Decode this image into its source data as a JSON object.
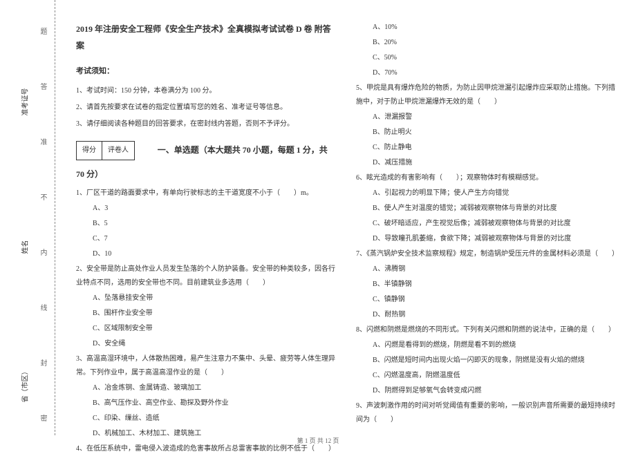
{
  "binding": {
    "field_province": "省（市区）",
    "field_name": "姓名",
    "field_ticket": "准考证号",
    "dash1": "密",
    "dash2": "封",
    "dash3": "线",
    "dash4": "内",
    "dash5": "不",
    "dash6": "准",
    "dash7": "答",
    "dash8": "题"
  },
  "header": {
    "title": "2019 年注册安全工程师《安全生产技术》全真模拟考试试卷 D 卷 附答案",
    "notice_label": "考试须知：",
    "instr1": "1、考试时间：150 分钟，本卷满分为 100 分。",
    "instr2": "2、请首先按要求在试卷的指定位置填写您的姓名、准考证号等信息。",
    "instr3": "3、请仔细阅读各种题目的回答要求，在密封线内答题，否则不予评分。"
  },
  "score_box": {
    "col1": "得分",
    "col2": "评卷人"
  },
  "section1_title": "一、单选题（本大题共 70 小题，每题 1 分，共 70 分）",
  "q1": {
    "stem": "1、厂区干道的路面要求中，有单向行驶标志的主干道宽度不小于（　　）m。",
    "a": "A、3",
    "b": "B、5",
    "c": "C、7",
    "d": "D、10"
  },
  "q2": {
    "stem": "2、安全带是防止高处作业人员发生坠落的个人防护装备。安全带的种类较多，因各行业特点不同，选用的安全带也不同。目前建筑业多选用（　　）",
    "a": "A、坠落悬挂安全带",
    "b": "B、围杆作业安全带",
    "c": "C、区域限制安全带",
    "d": "D、安全绳"
  },
  "q3": {
    "stem": "3、高温高湿环境中，人体散热困难，易产生注意力不集中、头晕、疲劳等人体生理异常。下列作业中，属于高温高湿作业的是（　　）",
    "a": "A、冶金炼钢、金属铸造、玻璃加工",
    "b": "B、高气压作业、高空作业、勘探及野外作业",
    "c": "C、印染、缫丝、造纸",
    "d": "D、机械加工、木材加工、建筑施工"
  },
  "q4": {
    "stem": "4、在低压系统中，雷电侵入波造成的危害事故所占总雷害事故的比例不低于（　　）"
  },
  "q4_opts": {
    "a": "A、10%",
    "b": "B、20%",
    "c": "C、50%",
    "d": "D、70%"
  },
  "q5": {
    "stem": "5、甲烷是具有爆炸危险的物质，为防止因甲烷泄漏引起爆炸应采取防止措施。下列措施中，对于防止甲烷泄漏爆炸无效的是（　　）",
    "a": "A、泄漏报警",
    "b": "B、防止明火",
    "c": "C、防止静电",
    "d": "D、减压措施"
  },
  "q6": {
    "stem": "6、眩光造成的有害影响有（　　）；观察物体时有模糊感觉。",
    "a": "A、引起视力的明显下降；使人产生方向错觉",
    "b": "B、使人产生对温度的错觉；减弱被观察物体与背景的对比度",
    "c": "C、破坏暗适应，产生视觉后像；减弱被观察物体与背景的对比度",
    "d": "D、导致瞳孔肌萎缩，食欲下降；减弱被观察物体与背景的对比度"
  },
  "q7": {
    "stem": "7、《蒸汽锅炉安全技术监察规程》规定，制造锅炉受压元件的金属材料必须是（　　）",
    "a": "A、沸腾钢",
    "b": "B、半镇静钢",
    "c": "C、镇静钢",
    "d": "D、耐热钢"
  },
  "q8": {
    "stem": "8、闪燃和阴燃是燃烧的不同形式。下列有关闪燃和阴燃的说法中，正确的是（　　）",
    "a": "A、闪燃是看得到的燃烧，阴燃是看不到的燃烧",
    "b": "B、闪燃是短时间内出现火焰一闪即灭的现象，阴燃是没有火焰的燃烧",
    "c": "C、闪燃温度高，阴燃温度低",
    "d": "D、阴燃得到足够氧气会转变成闪燃"
  },
  "q9": {
    "stem": "9、声波刺激作用的时间对听觉阈值有重要的影响，一般识别声音所需要的最短持续时间为（　　）"
  },
  "footer": "第 1 页 共 12 页"
}
